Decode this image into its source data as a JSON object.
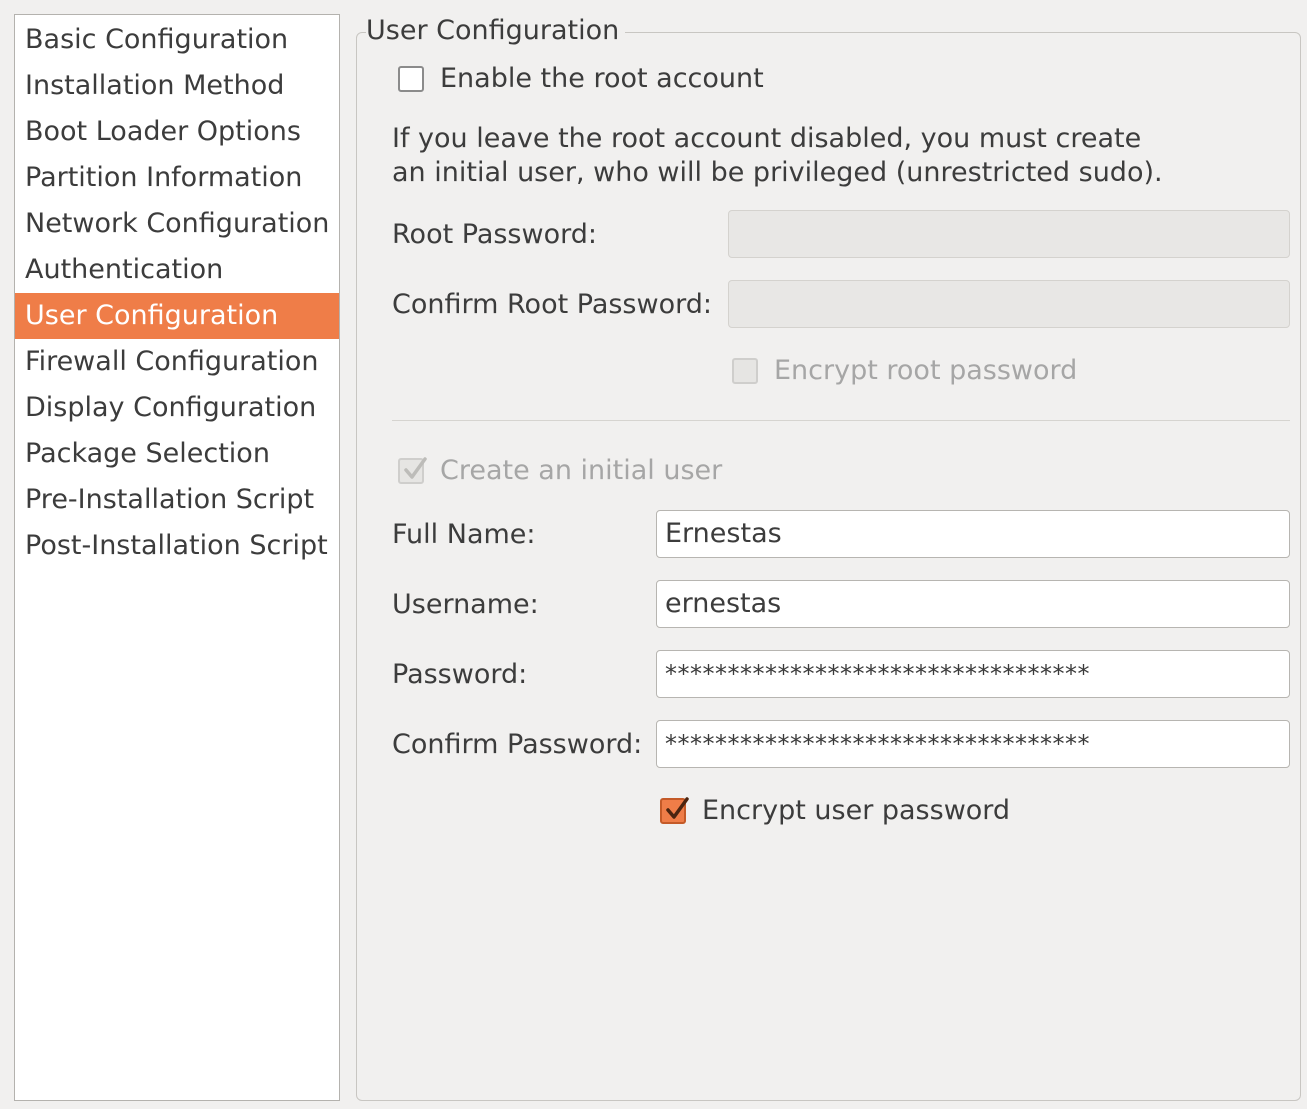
{
  "sidebar": {
    "items": [
      {
        "label": "Basic Configuration"
      },
      {
        "label": "Installation Method"
      },
      {
        "label": "Boot Loader Options"
      },
      {
        "label": "Partition Information"
      },
      {
        "label": "Network Configuration"
      },
      {
        "label": "Authentication"
      },
      {
        "label": "User Configuration"
      },
      {
        "label": "Firewall Configuration"
      },
      {
        "label": "Display Configuration"
      },
      {
        "label": "Package Selection"
      },
      {
        "label": "Pre-Installation Script"
      },
      {
        "label": "Post-Installation Script"
      }
    ],
    "selected_index": 6
  },
  "panel": {
    "title": "User Configuration",
    "enable_root": {
      "label": "Enable the root account",
      "checked": false
    },
    "info_line1": "If you leave the root account disabled, you must create",
    "info_line2": "an initial user, who will be privileged (unrestricted sudo).",
    "root_password": {
      "label": "Root Password:",
      "value": ""
    },
    "confirm_root_password": {
      "label": "Confirm Root Password:",
      "value": ""
    },
    "encrypt_root": {
      "label": "Encrypt root password",
      "checked": false
    },
    "create_user": {
      "label": "Create an initial user",
      "checked": true
    },
    "full_name": {
      "label": "Full Name:",
      "value": "Ernestas"
    },
    "username": {
      "label": "Username:",
      "value": "ernestas"
    },
    "password": {
      "label": "Password:",
      "value": "**********************************"
    },
    "confirm_password": {
      "label": "Confirm Password:",
      "value": "**********************************"
    },
    "encrypt_user": {
      "label": "Encrypt user password",
      "checked": true
    }
  },
  "colors": {
    "accent": "#ef7d48",
    "background": "#f1f0ef",
    "disabled_text": "#a6a6a6"
  }
}
